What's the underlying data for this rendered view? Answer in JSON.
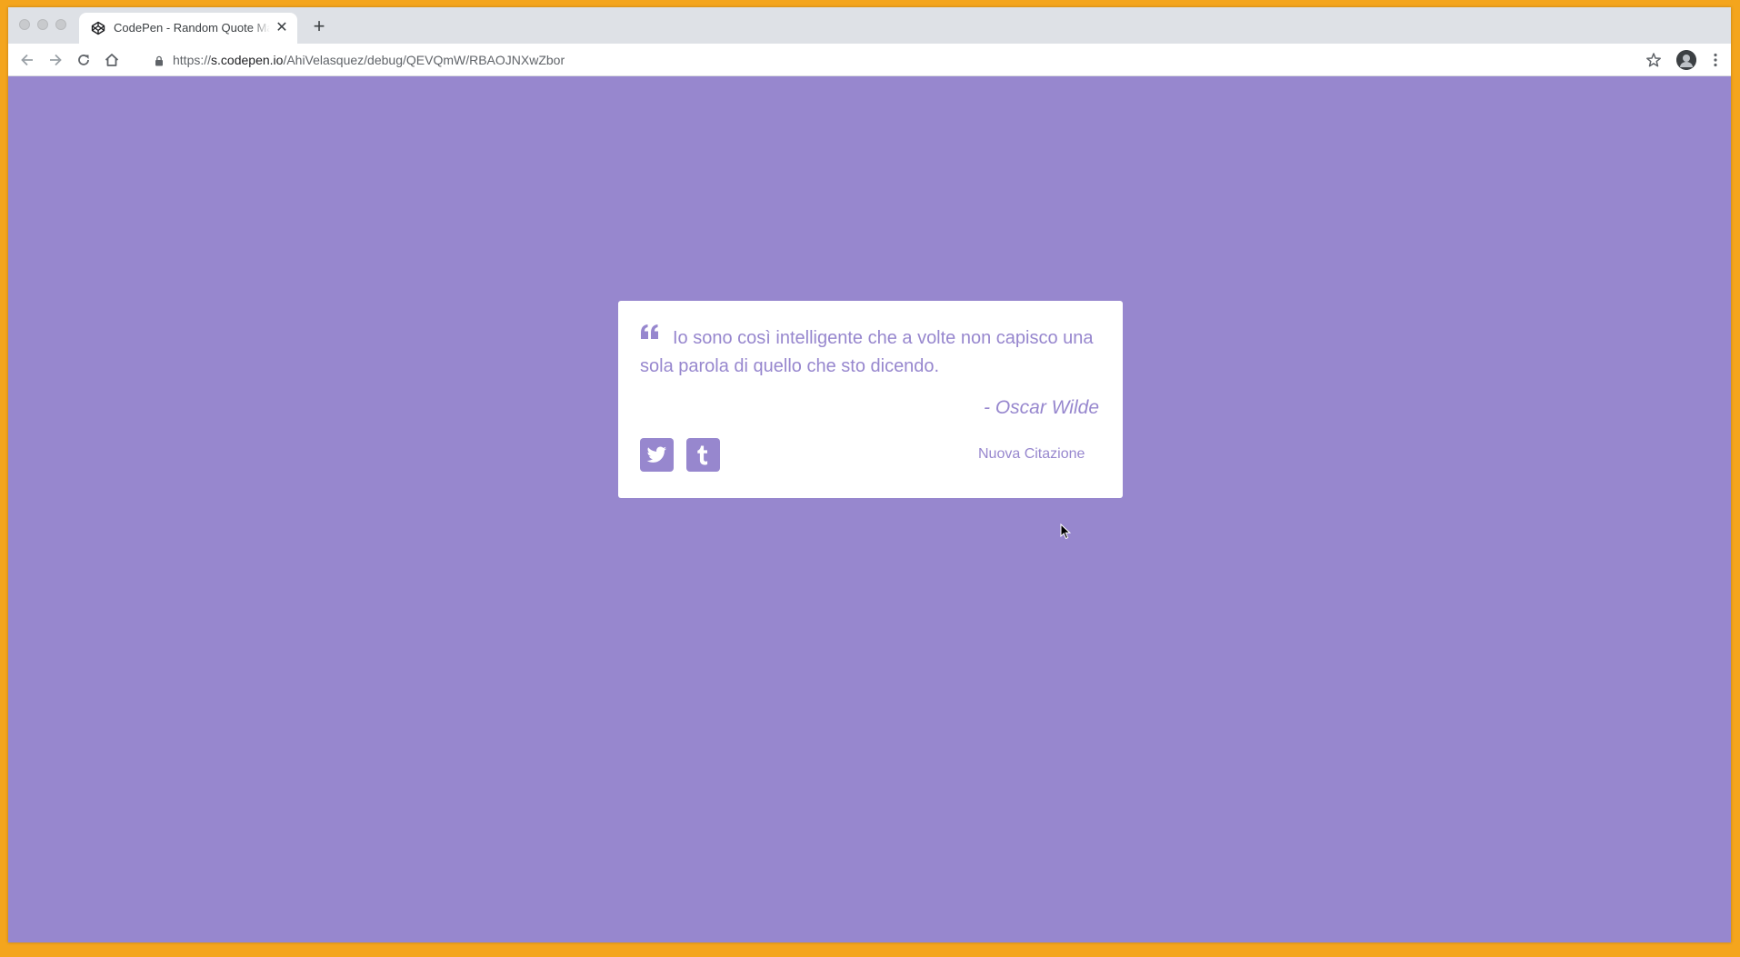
{
  "browser": {
    "tab": {
      "title": "CodePen - Random Quote Machine",
      "favicon": "codepen-icon",
      "close_icon": "close-icon"
    },
    "new_tab_icon": "plus-icon",
    "toolbar": {
      "back_icon": "back-arrow-icon",
      "forward_icon": "forward-arrow-icon",
      "reload_icon": "reload-icon",
      "home_icon": "home-icon",
      "lock_icon": "lock-icon",
      "url_scheme": "https://",
      "url_host": "s.codepen.io",
      "url_path": "/AhiVelasquez/debug/QEVQmW/RBAOJNXwZbor",
      "bookmark_icon": "star-icon",
      "profile_icon": "avatar",
      "menu_icon": "more-vert-icon"
    }
  },
  "quote_box": {
    "quote_icon": "quote-left-icon",
    "text": "Io sono così intelligente che a volte non capisco una sola parola di quello che sto dicendo.",
    "author": "- Oscar Wilde",
    "tweet_icon": "twitter-icon",
    "tumblr_icon": "tumblr-icon",
    "new_quote_label": "Nuova Citazione"
  },
  "colors": {
    "accent": "#9787ce",
    "background_frame": "#f4a51d",
    "card": "#ffffff"
  }
}
